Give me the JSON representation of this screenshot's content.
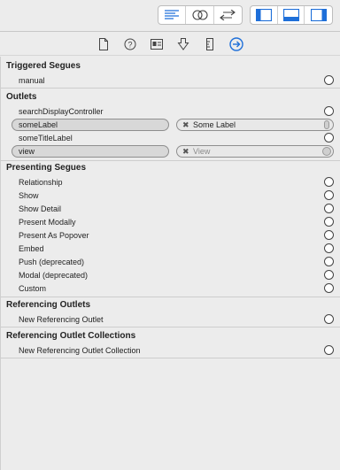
{
  "toolbar": {
    "editor_buttons": [
      {
        "icon": "standard-editor-icon",
        "active": true
      },
      {
        "icon": "assistant-editor-icon",
        "active": false
      },
      {
        "icon": "version-editor-icon",
        "active": false
      }
    ],
    "view_buttons": [
      {
        "icon": "navigator-toggle-icon",
        "active": true
      },
      {
        "icon": "debug-area-toggle-icon",
        "active": true
      },
      {
        "icon": "utilities-toggle-icon",
        "active": true
      }
    ],
    "accent": "#1e6fd9"
  },
  "inspector_tabs": [
    {
      "icon": "file-inspector-icon"
    },
    {
      "icon": "quick-help-icon"
    },
    {
      "icon": "identity-inspector-icon"
    },
    {
      "icon": "attributes-inspector-icon"
    },
    {
      "icon": "size-inspector-icon"
    },
    {
      "icon": "connections-inspector-icon",
      "active": true
    }
  ],
  "sections": {
    "triggered_segues": {
      "title": "Triggered Segues",
      "items": [
        "manual"
      ]
    },
    "outlets": {
      "title": "Outlets",
      "search_display": "searchDisplayController",
      "some_label": "someLabel",
      "some_label_target": "Some Label",
      "some_title_label": "someTitleLabel",
      "view": "view",
      "view_target": "View"
    },
    "presenting_segues": {
      "title": "Presenting Segues",
      "items": [
        "Relationship",
        "Show",
        "Show Detail",
        "Present Modally",
        "Present As Popover",
        "Embed",
        "Push (deprecated)",
        "Modal (deprecated)",
        "Custom"
      ]
    },
    "referencing_outlets": {
      "title": "Referencing Outlets",
      "items": [
        "New Referencing Outlet"
      ]
    },
    "referencing_outlet_collections": {
      "title": "Referencing Outlet Collections",
      "items": [
        "New Referencing Outlet Collection"
      ]
    }
  }
}
